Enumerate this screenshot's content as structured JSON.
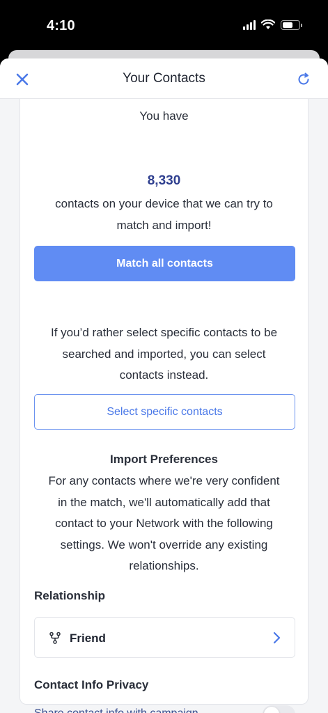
{
  "status_bar": {
    "time": "4:10"
  },
  "header": {
    "title": "Your Contacts"
  },
  "intro": {
    "line1": "You have",
    "count": "8,330",
    "line2": "contacts on your device that we can try to",
    "line3": "match and import!"
  },
  "match_button": {
    "label": "Match all contacts"
  },
  "select_text": {
    "line1": "If you’d rather select specific contacts to be",
    "line2": "searched and imported, you can select",
    "line3": "contacts instead."
  },
  "select_button": {
    "label": "Select specific contacts"
  },
  "import_prefs": {
    "title": "Import Preferences",
    "line1": "For any contacts where we're very confident",
    "line2": "in the match, we'll automatically add that",
    "line3": "contact to your Network with the following",
    "line4": "settings. We won't override any existing",
    "line5": "relationships."
  },
  "relationship": {
    "heading": "Relationship",
    "value": "Friend",
    "icon": "branch-icon"
  },
  "privacy": {
    "heading": "Contact Info Privacy",
    "share_label": "Share contact info with campaign",
    "share_enabled": false
  },
  "colors": {
    "primary": "#608cf3",
    "count_text": "#2f3f8f",
    "link_text": "#3a4e8f"
  }
}
